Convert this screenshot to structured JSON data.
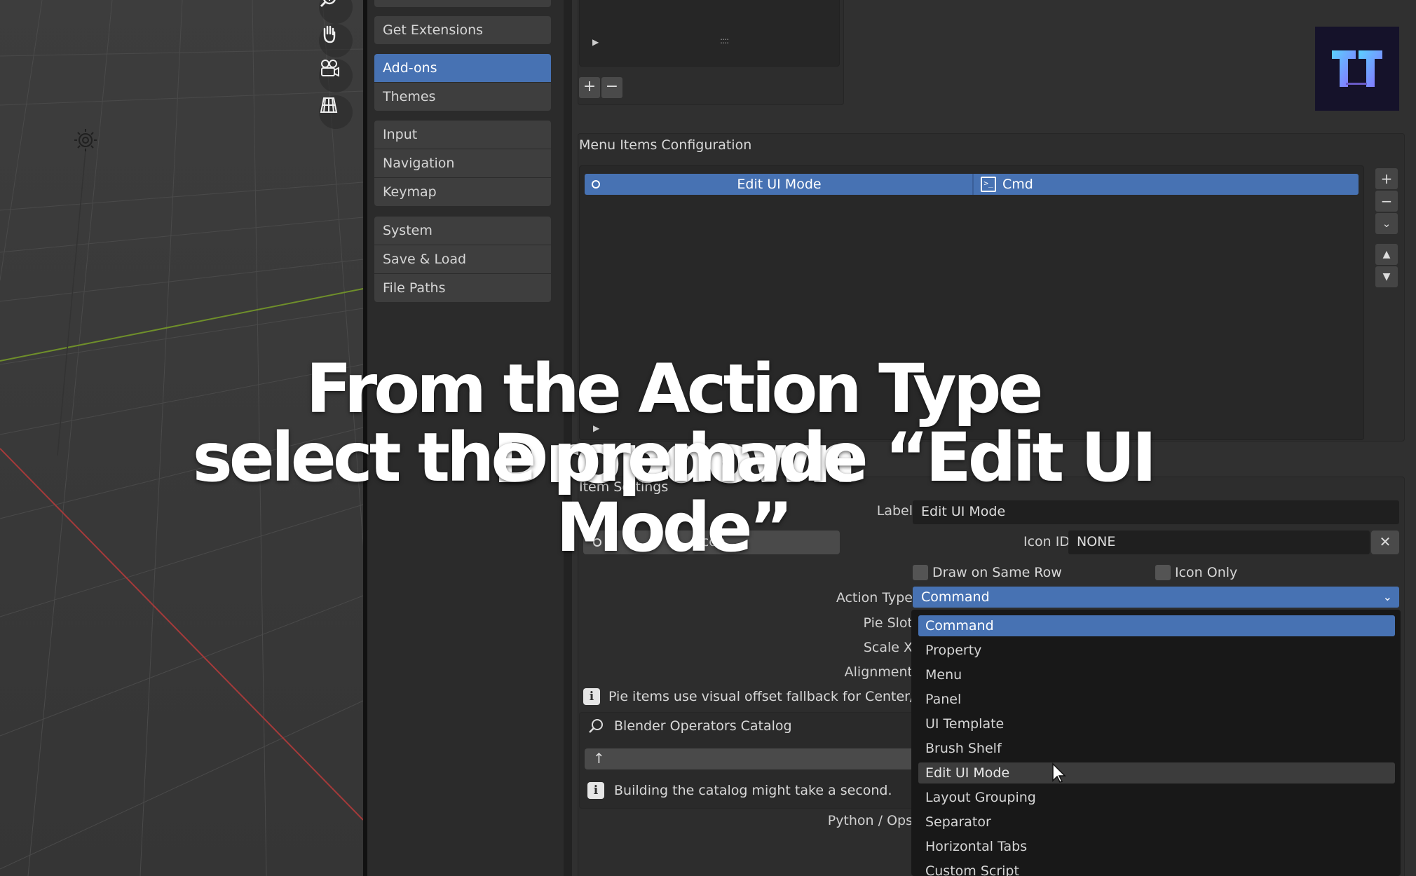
{
  "nav": {
    "get_extensions": "Get Extensions",
    "addons": "Add-ons",
    "themes": "Themes",
    "input": "Input",
    "navigation": "Navigation",
    "keymap": "Keymap",
    "system": "System",
    "save_load": "Save & Load",
    "file_paths": "File Paths"
  },
  "menu_items_config": {
    "title": "Menu Items Configuration",
    "row": {
      "name": "Edit UI Mode",
      "type": "Cmd"
    }
  },
  "item_settings": {
    "title": "Item Settings",
    "label_label": "Label",
    "label_value": "Edit UI Mode",
    "icon_button": "Icon",
    "icon_id_label": "Icon ID",
    "icon_id_value": "NONE",
    "draw_same_row": "Draw on Same Row",
    "icon_only": "Icon Only",
    "action_type_label": "Action Type",
    "action_type_value": "Command",
    "pie_slot_label": "Pie Slot",
    "scale_x_label": "Scale X",
    "alignment_label": "Alignment",
    "pie_info": "Pie items use visual offset fallback for Center/Righ",
    "catalog_label": "Blender Operators Catalog",
    "catalog_info": "Building the catalog might take a second.",
    "python_ops_label": "Python / Ops"
  },
  "dropdown": {
    "options": [
      "Command",
      "Property",
      "Menu",
      "Panel",
      "UI Template",
      "Brush Shelf",
      "Edit UI Mode",
      "Layout Grouping",
      "Separator",
      "Horizontal Tabs",
      "Custom Script"
    ],
    "selected": "Command",
    "hovered": "Edit UI Mode"
  },
  "caption": {
    "line1": "From the Action Type Dropdown",
    "line2": "select the premade “Edit UI Mode”"
  },
  "colors": {
    "accent": "#4772b3",
    "background": "#303030"
  }
}
